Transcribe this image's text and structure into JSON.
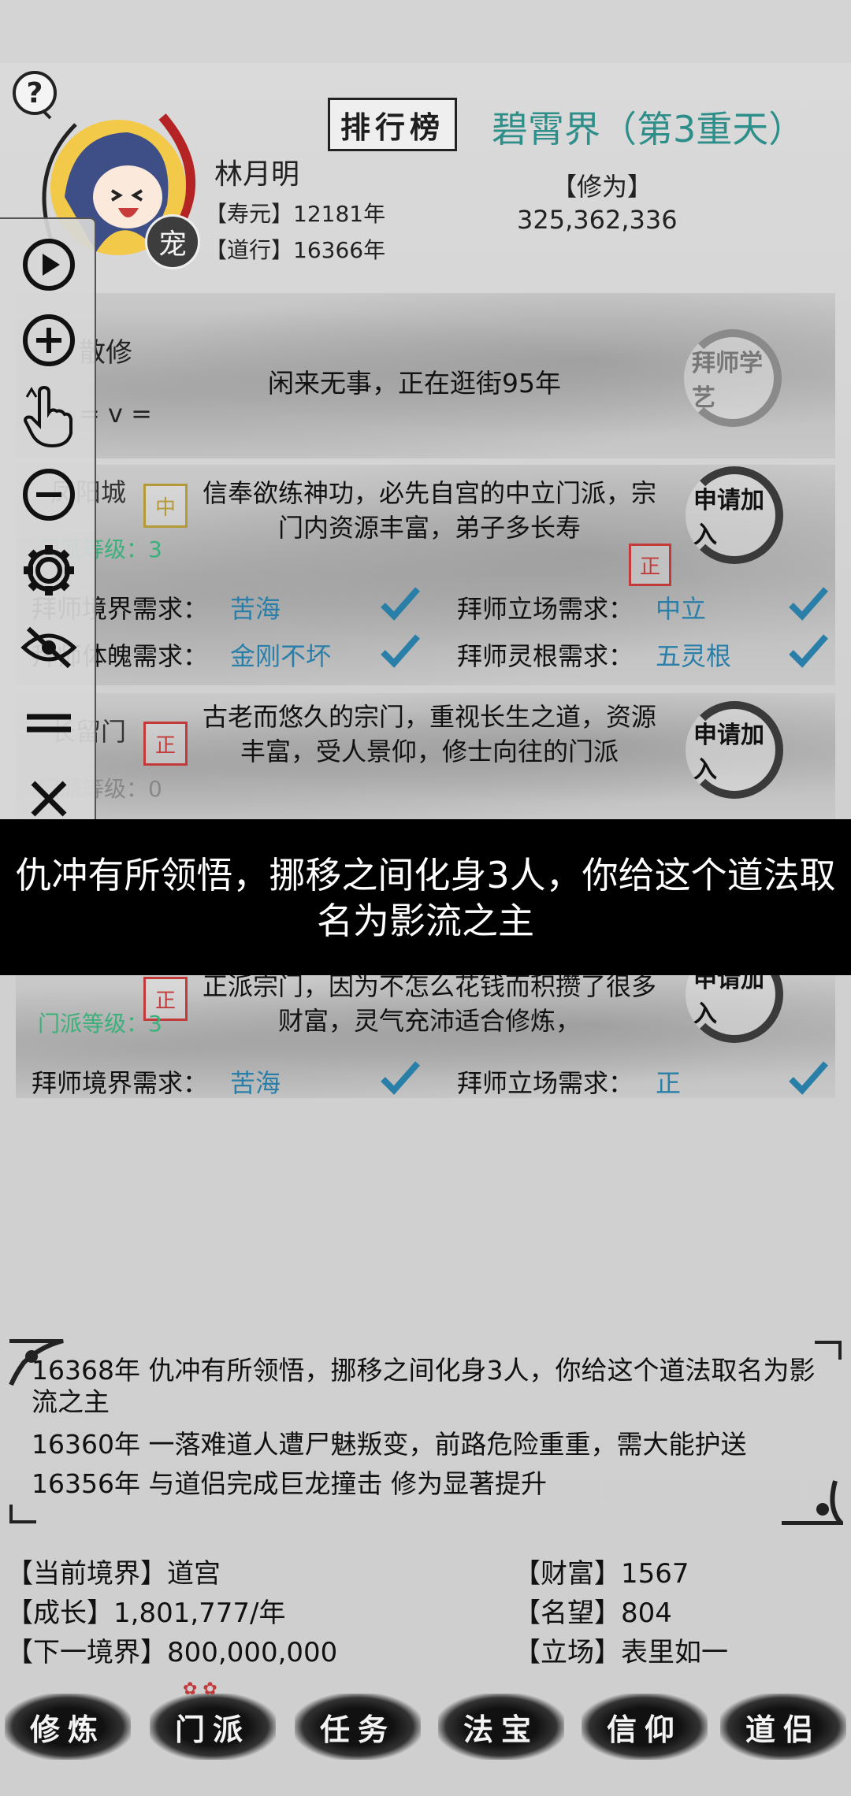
{
  "header": {
    "name": "林月明",
    "lifespan_label": "【寿元】",
    "lifespan_value": "12181年",
    "dao_label": "【道行】",
    "dao_value": "16366年",
    "pet_badge": "宠",
    "rank_button": "排行榜",
    "realm": "碧霄界（第3重天）",
    "cultivation_label": "【修为】",
    "cultivation_value": "325,362,336"
  },
  "status": {
    "sect_type": "散修",
    "emoticon": "= v =",
    "activity": "闲来无事，正在逛街95年",
    "activity_action": "拜师学艺"
  },
  "sects": [
    {
      "name": "凤阳城",
      "stamp": "中",
      "level_label": "门派等级：",
      "level": "3",
      "description": "信奉欲练神功，必先自宫的中立门派，宗门内资源丰富，弟子多长寿",
      "action": "申请加入",
      "req1_label": "拜师境界需求：",
      "req1_value": "苦海",
      "req2_label": "拜师立场需求：",
      "req2_value": "中立",
      "req3_label": "拜师体魄需求：",
      "req3_value": "金刚不坏",
      "req4_label": "拜师灵根需求：",
      "req4_value": "五灵根"
    },
    {
      "name": "长留门",
      "stamp": "正",
      "level_label": "门派等级：",
      "level": "0",
      "description": "古老而悠久的宗门，重视长生之道，资源丰富，受人景仰，修士向往的门派",
      "action": "申请加入"
    },
    {
      "stamp": "正",
      "level_label": "门派等级：",
      "level": "3",
      "description": "正派宗门，因为不怎么花钱而积攒了很多财富，灵气充沛适合修炼，",
      "action": "申请加入",
      "req1_label": "拜师境界需求：",
      "req1_value": "苦海",
      "req2_label": "拜师立场需求：",
      "req2_value": "正"
    }
  ],
  "toast": "仇冲有所领悟，挪移之间化身3人，你给这个道法取名为影流之主",
  "log": [
    "16368年 仇冲有所领悟，挪移之间化身3人，你给这个道法取名为影流之主",
    "16360年 一落难道人遭尸魅叛变，前路危险重重，需大能护送",
    "16356年 与道侣完成巨龙撞击 修为显著提升"
  ],
  "stats": {
    "realm_label": "【当前境界】",
    "realm_value": "道宫",
    "growth_label": "【成长】",
    "growth_value": "1,801,777/年",
    "next_label": "【下一境界】",
    "next_value": "800,000,000",
    "wealth_label": "【财富】",
    "wealth_value": "1567",
    "fame_label": "【名望】",
    "fame_value": "804",
    "stance_label": "【立场】",
    "stance_value": "表里如一"
  },
  "nav": [
    "修炼",
    "门派",
    "任务",
    "法宝",
    "信仰",
    "道侣"
  ],
  "colors": {
    "accent_teal": "#2e8f8a",
    "requirement_blue": "#2a7fa8",
    "level_green": "#3bb07a",
    "stamp_red": "#c23a3a"
  }
}
